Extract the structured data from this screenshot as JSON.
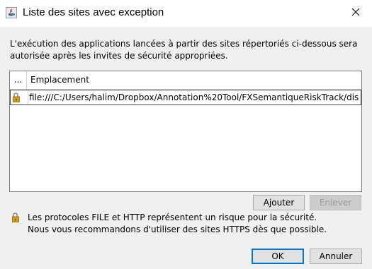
{
  "window": {
    "title": "Liste des sites avec exception",
    "close_symbol": "✕",
    "app_icon": "java-icon"
  },
  "description": "L'exécution des applications lancées à partir des sites répertoriés ci-dessous sera autorisée après les invites de sécurité appropriées.",
  "table": {
    "columns": [
      "...",
      "Emplacement"
    ],
    "rows": [
      {
        "icon": "lock-icon",
        "location": "file:///C:/Users/halim/Dropbox/Annotation%20Tool/FXSemantiqueRiskTrack/dis..."
      }
    ]
  },
  "buttons": {
    "add": "Ajouter",
    "remove": "Enlever",
    "ok": "OK",
    "cancel": "Annuler"
  },
  "warning": {
    "icon": "lock-icon",
    "line1": "Les protocoles FILE et HTTP représentent un risque pour la sécurité.",
    "line2": "Nous vous recommandons d'utiliser des sites HTTPS dès que possible."
  },
  "colors": {
    "default_button_border": "#0078d7",
    "lock_gold": "#d4a017"
  }
}
